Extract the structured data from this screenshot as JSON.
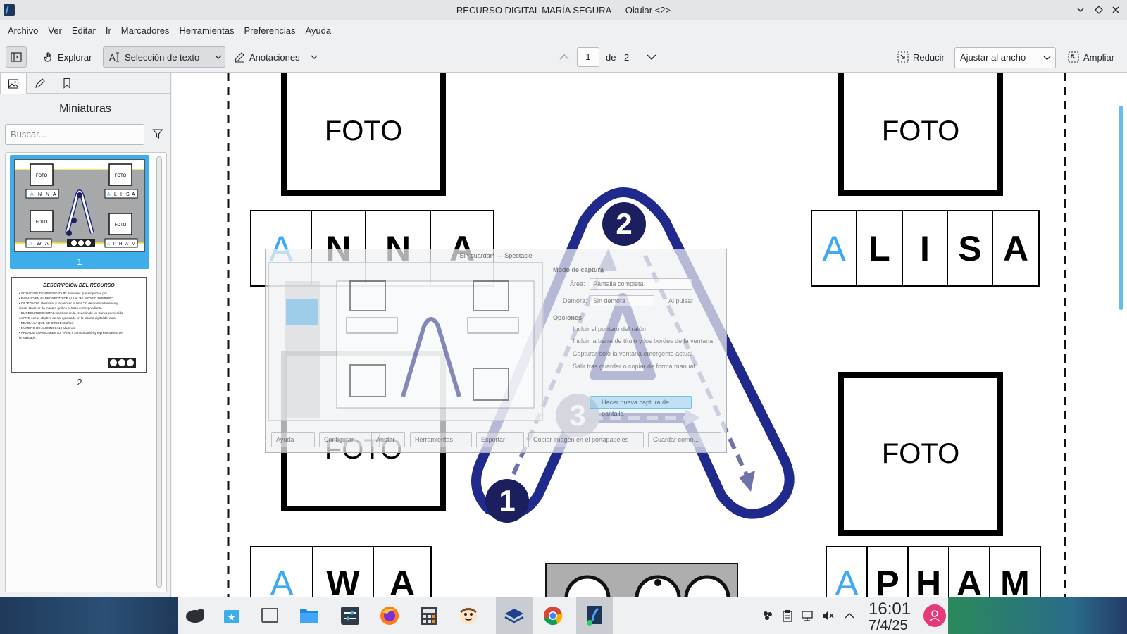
{
  "window": {
    "title": "RECURSO DIGITAL MARÍA SEGURA — Okular <2>"
  },
  "menu": [
    "Archivo",
    "Ver",
    "Editar",
    "Ir",
    "Marcadores",
    "Herramientas",
    "Preferencias",
    "Ayuda"
  ],
  "toolbar": {
    "browse_label": "Explorar",
    "text_select_label": "Selección de texto",
    "annotations_label": "Anotaciones",
    "page_current": "1",
    "page_of": "de",
    "page_total": "2",
    "zoom_out_label": "Reducir",
    "zoom_mode": "Ajustar al ancho",
    "zoom_in_label": "Ampliar"
  },
  "sidebar": {
    "title": "Miniaturas",
    "search_placeholder": "Buscar...",
    "thumbnails": [
      {
        "label": "1",
        "selected": true
      },
      {
        "label": "2",
        "selected": false
      }
    ],
    "thumb2": {
      "title": "DESCRIPCIÓN DEL RECURSO",
      "lines": [
        "• SITUACIÓN DE APRENDIZAJE: Nombres que empiezan por...",
        "• BASADO EN EL PROYECTO DE AULA: \"MI PROPIO NOMBRE\".",
        "• OBJETIVOS: Identificar y reconocer la letra \"A\" de manera fonética y",
        "  visual. Realizar de manera gráfica el trazo correspondiente.",
        "• EL RECURSO DIGITAL: consiste en la creación de un Canva convertido",
        "  en PNG con el objetivo de ser ejecutado en la pizarra digital del aula.",
        "• EDAD A LA QUE SE DIRIGE: 3 años.",
        "• NÚMERO DE ALUMNOS: 19 alumnos.",
        "• ÁREA DE CONOCIMIENTO: «Área II comunicación y representación de",
        "  la realidad»."
      ]
    }
  },
  "document": {
    "foto_label": "FOTO",
    "names": {
      "anna": [
        "A",
        "N",
        "N",
        "A"
      ],
      "alisa": [
        "A",
        "L",
        "I",
        "S",
        "A"
      ],
      "awa": [
        "A",
        "W",
        "A"
      ],
      "apham": [
        "A",
        "P",
        "H",
        "A",
        "M"
      ]
    },
    "steps": [
      "1",
      "2",
      "3"
    ],
    "colors": {
      "letter_blue": "#3fa9f5",
      "trace_navy": "#1f2a8c",
      "step_circle": "#1c1f5e"
    }
  },
  "spectacle": {
    "title": "Sin guardar* — Spectacle",
    "mode_header": "Modo de captura",
    "area_label": "Área:",
    "area_value": "Pantalla completa",
    "delay_label": "Demora:",
    "delay_value": "Sin demora",
    "on_click_label": "Al pulsar",
    "options_header": "Opciones",
    "options": [
      "Incluir el puntero del ratón",
      "Incluir la barra de título y los bordes de la ventana",
      "Capturar solo la ventana emergente actual",
      "Salir tras guardar o copiar de forma manual"
    ],
    "new_capture_label": "Hacer nueva captura de pantalla",
    "buttons": [
      "Ayuda",
      "Configurar...",
      "Anotar",
      "Herramientas",
      "Exportar",
      "Copiar imagen en el portapapeles",
      "Guardar como..."
    ]
  },
  "taskbar": {
    "time": "16:01",
    "date": "7/4/25",
    "accent": "#e6397a"
  }
}
